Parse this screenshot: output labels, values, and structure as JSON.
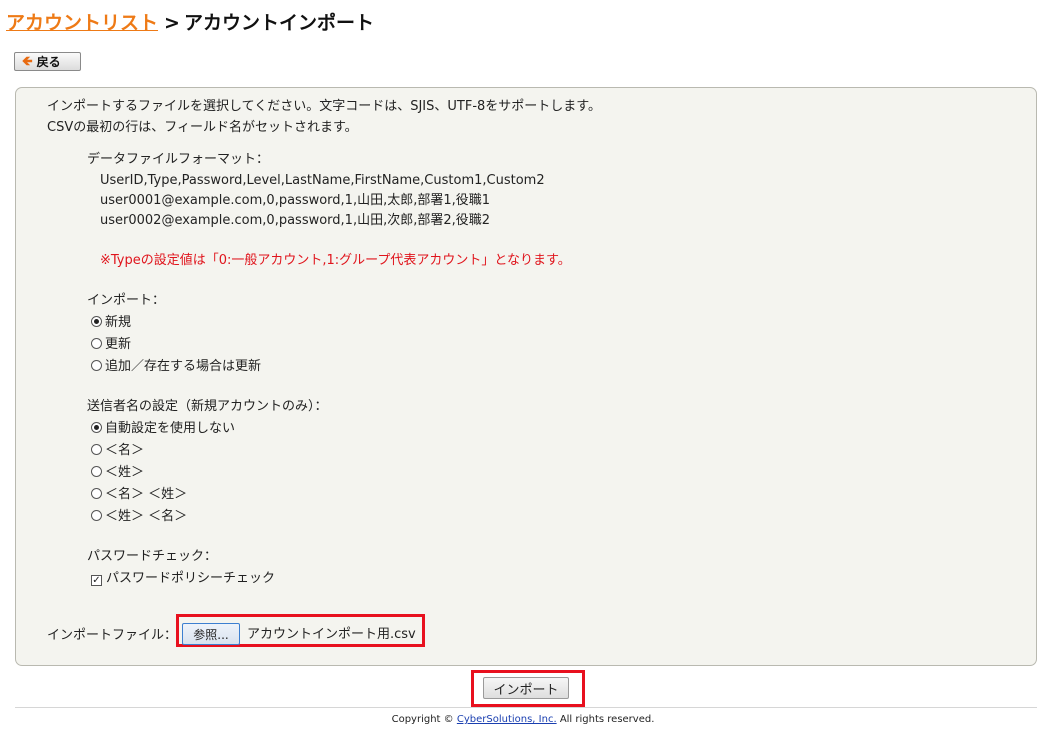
{
  "breadcrumb": {
    "parent_link": "アカウントリスト",
    "separator": ">",
    "current": "アカウントインポート"
  },
  "toolbar": {
    "back_label": "戻る"
  },
  "instructions": {
    "line1": "インポートするファイルを選択してください。文字コードは、SJIS、UTF-8をサポートします。",
    "line2": "CSVの最初の行は、フィールド名がセットされます。"
  },
  "format": {
    "label": "データファイルフォーマット：",
    "rows": [
      "UserID,Type,Password,Level,LastName,FirstName,Custom1,Custom2",
      "user0001@example.com,0,password,1,山田,太郎,部署1,役職1",
      "user0002@example.com,0,password,1,山田,次郎,部署2,役職2"
    ],
    "note": "※Typeの設定値は「0:一般アカウント,1:グループ代表アカウント」となります。"
  },
  "import_mode": {
    "label": "インポート：",
    "options": [
      "新規",
      "更新",
      "追加／存在する場合は更新"
    ],
    "selected": 0
  },
  "sender_name": {
    "label": "送信者名の設定（新規アカウントのみ）：",
    "options": [
      "自動設定を使用しない",
      "＜名＞",
      "＜姓＞",
      "＜名＞ ＜姓＞",
      "＜姓＞ ＜名＞"
    ],
    "selected": 0
  },
  "password_check": {
    "label": "パスワードチェック：",
    "option": "パスワードポリシーチェック",
    "checked": true
  },
  "file": {
    "label": "インポートファイル：",
    "browse_label": "参照...",
    "filename": "アカウントインポート用.csv"
  },
  "actions": {
    "import_label": "インポート"
  },
  "footer": {
    "prefix": "Copyright ©",
    "company": "CyberSolutions, Inc.",
    "suffix": "All rights reserved."
  },
  "colors": {
    "link": "#ee7a16",
    "note": "#e0141c",
    "highlight": "#e8101e",
    "panel_bg": "#f4f4ef"
  }
}
